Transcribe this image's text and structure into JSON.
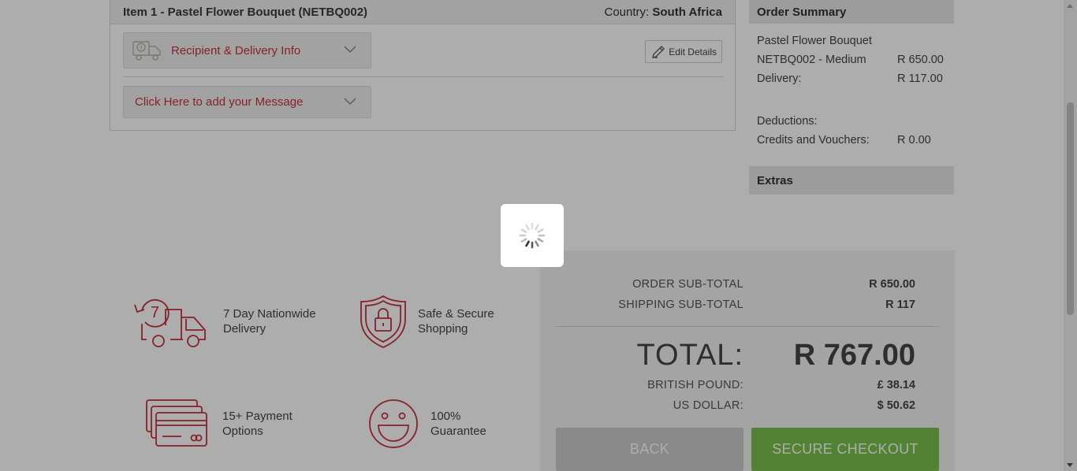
{
  "item": {
    "title": "Item 1 - Pastel Flower Bouquet (NETBQ002)",
    "country_label": "Country:",
    "country_value": "South Africa",
    "recipient_label": "Recipient & Delivery Info",
    "message_label": "Click Here to add your Message",
    "edit_label": "Edit Details"
  },
  "summary": {
    "title": "Order Summary",
    "product": "Pastel Flower Bouquet",
    "variant": "NETBQ002 - Medium",
    "variant_price": "R 650.00",
    "delivery_label": "Delivery:",
    "delivery_price": "R 117.00",
    "deductions_label": "Deductions:",
    "credits_label": "Credits and Vouchers:",
    "credits_value": "R 0.00",
    "extras_title": "Extras"
  },
  "features": {
    "delivery_line1": "7 Day Nationwide",
    "delivery_line2": "Delivery",
    "delivery_badge": "7",
    "secure_line1": "Safe & Secure",
    "secure_line2": "Shopping",
    "payment_line1": "15+ Payment",
    "payment_line2": "Options",
    "guarantee_line1": "100%",
    "guarantee_line2": "Guarantee"
  },
  "totals": {
    "order_subtotal_label": "ORDER SUB-TOTAL",
    "order_subtotal_value": "R 650.00",
    "shipping_subtotal_label": "SHIPPING SUB-TOTAL",
    "shipping_subtotal_value": "R 117",
    "total_label": "TOTAL:",
    "total_value": "R 767.00",
    "gbp_label": "BRITISH POUND:",
    "gbp_value": "£ 38.14",
    "usd_label": "US DOLLAR:",
    "usd_value": "$ 50.62",
    "back_label": "BACK",
    "checkout_label": "SECURE CHECKOUT"
  },
  "colors": {
    "accent_red": "#c8323e",
    "checkout_green": "#79c24a",
    "overlay": "rgba(0,0,0,0.32)"
  }
}
